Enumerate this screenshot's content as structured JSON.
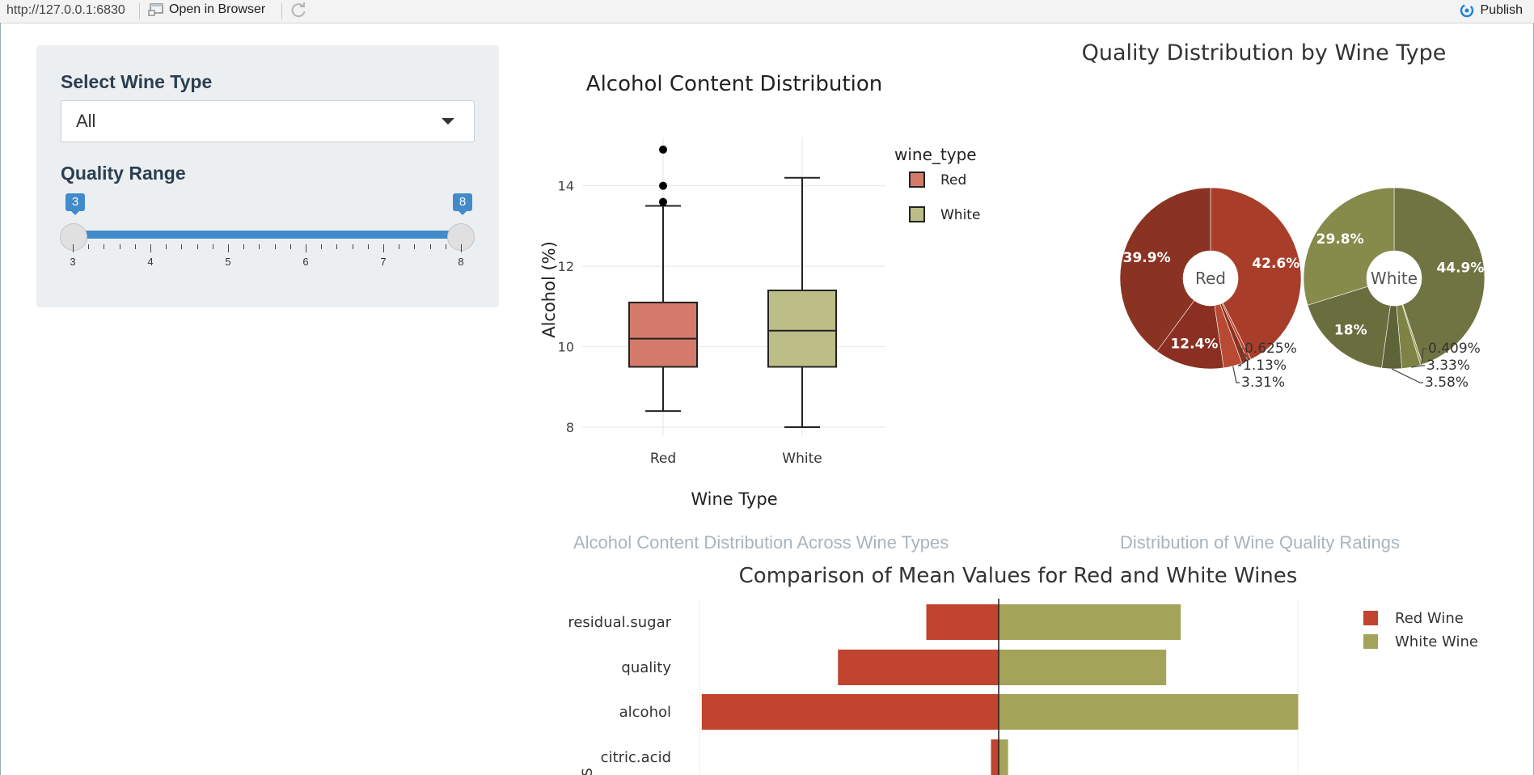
{
  "topbar": {
    "url": "http://127.0.0.1:6830",
    "open_in_browser": "Open in Browser",
    "publish": "Publish"
  },
  "sidebar": {
    "wine_type_label": "Select Wine Type",
    "wine_type_value": "All",
    "quality_label": "Quality Range",
    "quality_min": 3,
    "quality_max": 8,
    "quality_low_label": "3",
    "quality_high_label": "8",
    "ticks": [
      "3",
      "4",
      "5",
      "6",
      "7",
      "8"
    ]
  },
  "captions": {
    "box": "Alcohol Content Distribution Across Wine Types",
    "pie": "Distribution of Wine Quality Ratings"
  },
  "colors": {
    "red": "#c0442e",
    "red_box": "#d47a6b",
    "white": "#a3a35a",
    "white_box": "#bdbe87"
  },
  "chart_data": [
    {
      "type": "box",
      "title": "Alcohol Content Distribution",
      "xlabel": "Wine Type",
      "ylabel": "Alcohol (%)",
      "ylim": [
        7.8,
        15.2
      ],
      "yticks": [
        8,
        10,
        12,
        14
      ],
      "legend_title": "wine_type",
      "legend": [
        "Red",
        "White"
      ],
      "categories": [
        "Red",
        "White"
      ],
      "boxes": [
        {
          "name": "Red",
          "min": 8.4,
          "q1": 9.5,
          "median": 10.2,
          "q3": 11.1,
          "max": 13.5,
          "outliers": [
            13.6,
            14.0,
            14.9
          ]
        },
        {
          "name": "White",
          "min": 8.0,
          "q1": 9.5,
          "median": 10.4,
          "q3": 11.4,
          "max": 14.2,
          "outliers": []
        }
      ]
    },
    {
      "type": "pie",
      "title": "Quality Distribution by Wine Type",
      "pies": [
        {
          "name": "Red",
          "slices": [
            {
              "label": "42.6%",
              "value": 42.6
            },
            {
              "label": "0.625%",
              "value": 0.625
            },
            {
              "label": "1.13%",
              "value": 1.13
            },
            {
              "label": "3.31%",
              "value": 3.31
            },
            {
              "label": "12.4%",
              "value": 12.4
            },
            {
              "label": "39.9%",
              "value": 39.9
            }
          ]
        },
        {
          "name": "White",
          "slices": [
            {
              "label": "44.9%",
              "value": 44.9
            },
            {
              "label": "0.409%",
              "value": 0.409
            },
            {
              "label": "3.33%",
              "value": 3.33
            },
            {
              "label": "3.58%",
              "value": 3.58
            },
            {
              "label": "18%",
              "value": 18.0
            },
            {
              "label": "29.8%",
              "value": 29.8
            }
          ]
        }
      ]
    },
    {
      "type": "bar",
      "orientation": "horizontal-diverging",
      "title": "Comparison of Mean Values for Red and White Wines",
      "categories": [
        "residual.sugar",
        "quality",
        "alcohol",
        "citric.acid"
      ],
      "xlim": [
        -10.5,
        10.5
      ],
      "series": [
        {
          "name": "Red Wine",
          "values": [
            -2.54,
            -5.64,
            -10.42,
            -0.27
          ]
        },
        {
          "name": "White Wine",
          "values": [
            6.39,
            5.88,
            10.51,
            0.33
          ]
        }
      ],
      "truncated_axis_label": "S"
    }
  ]
}
